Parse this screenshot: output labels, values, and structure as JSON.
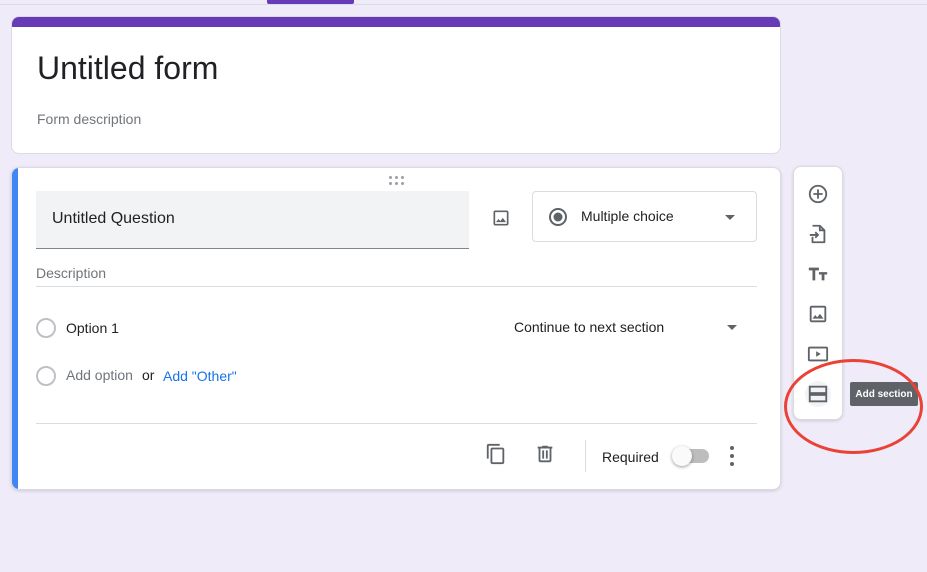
{
  "form": {
    "title": "Untitled form",
    "description_placeholder": "Form description"
  },
  "question": {
    "title": "Untitled Question",
    "type": "Multiple choice",
    "description_placeholder": "Description",
    "options": [
      {
        "label": "Option 1",
        "goto": "Continue to next section"
      }
    ],
    "add_option_label": "Add option",
    "or_label": "or",
    "add_other_label": "Add \"Other\"",
    "required_label": "Required",
    "required": false
  },
  "side_toolbar": {
    "tools": [
      {
        "icon": "add-circle-icon",
        "label": "Add question"
      },
      {
        "icon": "import-icon",
        "label": "Import questions"
      },
      {
        "icon": "title-text-icon",
        "label": "Add title and description"
      },
      {
        "icon": "image-icon",
        "label": "Add image"
      },
      {
        "icon": "video-icon",
        "label": "Add video"
      },
      {
        "icon": "section-icon",
        "label": "Add section"
      }
    ],
    "tooltip": "Add section"
  },
  "colors": {
    "accent": "#673ab7",
    "question_accent": "#4285f4",
    "link": "#1a73e8",
    "background": "#f0ebf8",
    "highlight": "#ea4335"
  }
}
